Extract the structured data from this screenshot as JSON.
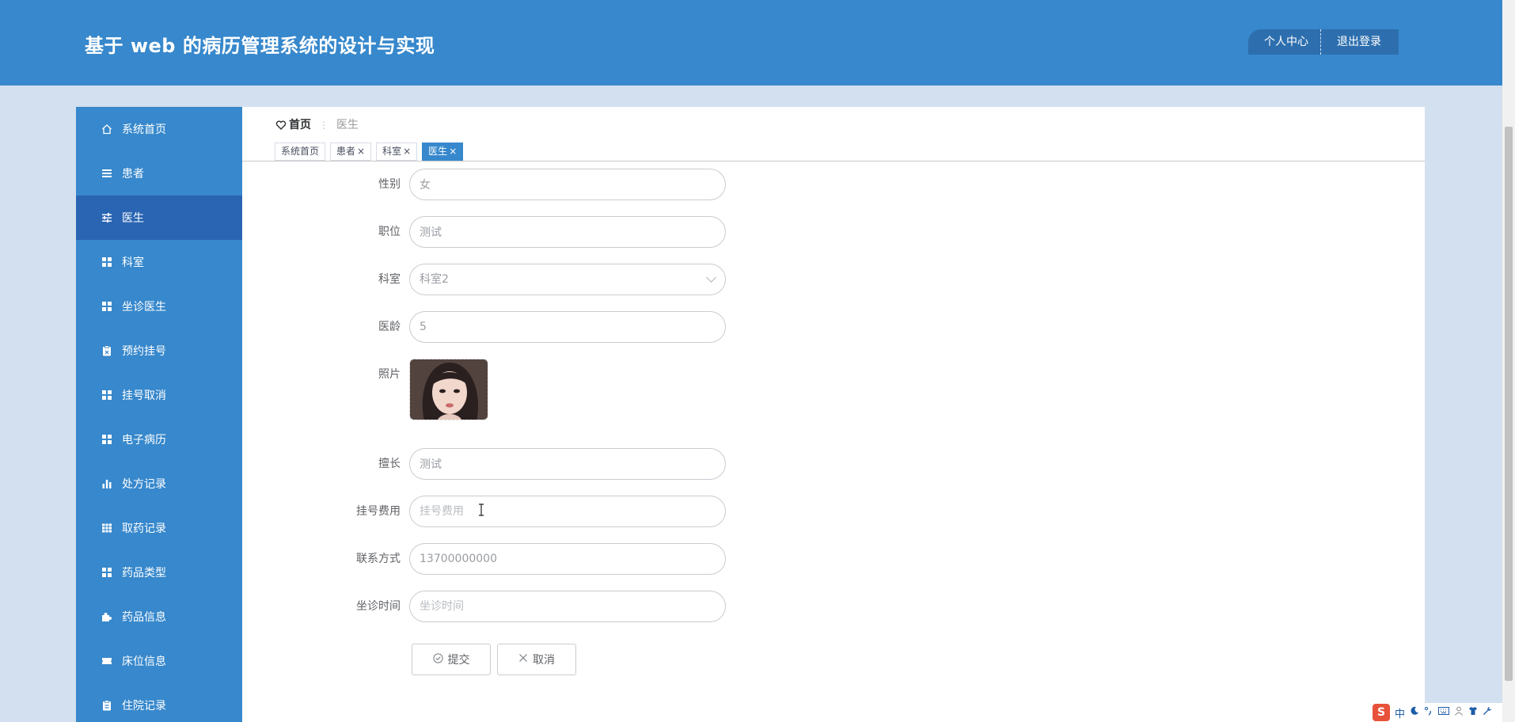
{
  "header": {
    "title": "基于 web 的病历管理系统的设计与实现",
    "profile_label": "个人中心",
    "logout_label": "退出登录"
  },
  "sidebar": {
    "items": [
      {
        "label": "系统首页",
        "icon": "home-icon"
      },
      {
        "label": "患者",
        "icon": "list-icon"
      },
      {
        "label": "医生",
        "icon": "sliders-icon",
        "active": true
      },
      {
        "label": "科室",
        "icon": "grid-icon"
      },
      {
        "label": "坐诊医生",
        "icon": "grid-icon"
      },
      {
        "label": "预约挂号",
        "icon": "clipboard-icon"
      },
      {
        "label": "挂号取消",
        "icon": "grid-icon"
      },
      {
        "label": "电子病历",
        "icon": "grid-icon"
      },
      {
        "label": "处方记录",
        "icon": "bar-chart-icon"
      },
      {
        "label": "取药记录",
        "icon": "table-icon"
      },
      {
        "label": "药品类型",
        "icon": "grid-icon"
      },
      {
        "label": "药品信息",
        "icon": "puzzle-icon"
      },
      {
        "label": "床位信息",
        "icon": "ticket-icon"
      },
      {
        "label": "住院记录",
        "icon": "clipboard-icon"
      }
    ]
  },
  "breadcrumb": {
    "home": "首页",
    "separator": "⋮",
    "current": "医生"
  },
  "tabs": [
    {
      "label": "系统首页",
      "closable": false
    },
    {
      "label": "患者",
      "closable": true
    },
    {
      "label": "科室",
      "closable": true
    },
    {
      "label": "医生",
      "closable": true,
      "active": true
    }
  ],
  "tab_close_glyph": "×",
  "form": {
    "gender": {
      "label": "性别",
      "value": "女"
    },
    "position": {
      "label": "职位",
      "value": "测试"
    },
    "department": {
      "label": "科室",
      "value": "科室2"
    },
    "seniority": {
      "label": "医龄",
      "value": "5"
    },
    "photo": {
      "label": "照片"
    },
    "specialty": {
      "label": "擅长",
      "value": "测试"
    },
    "fee": {
      "label": "挂号费用",
      "placeholder": "挂号费用",
      "value": ""
    },
    "contact": {
      "label": "联系方式",
      "value": "13700000000"
    },
    "schedule": {
      "label": "坐诊时间",
      "placeholder": "坐诊时间",
      "value": ""
    },
    "submit_label": "提交",
    "cancel_label": "取消"
  },
  "ime": {
    "logo": "S",
    "mode": "中"
  },
  "colors": {
    "primary": "#3788cc",
    "sidebar_active": "#2a65b3",
    "page_bg": "#d3e0ef"
  }
}
